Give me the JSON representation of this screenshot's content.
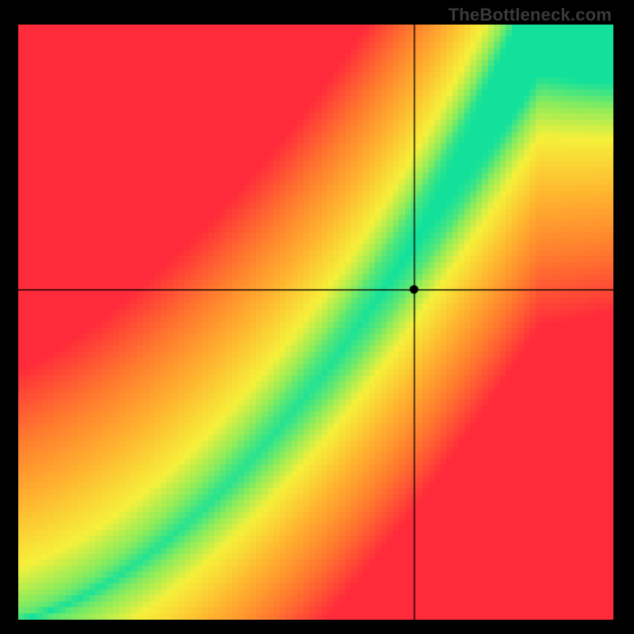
{
  "watermark": "TheBottleneck.com",
  "chart_data": {
    "type": "heatmap",
    "title": "",
    "xlabel": "",
    "ylabel": "",
    "xlim": [
      0,
      1
    ],
    "ylim": [
      0,
      1
    ],
    "crosshair": {
      "x": 0.665,
      "y": 0.555
    },
    "marker": {
      "x": 0.665,
      "y": 0.555
    },
    "optimal_band": {
      "description": "Green optimal region: a curved band from bottom-left to top-right. Color encodes distance from this band (green=on band, yellow=near, red=far).",
      "slope": 1.25,
      "curvature": 0.7,
      "band_halfwidth_at_min": 0.006,
      "band_halfwidth_at_max": 0.085
    },
    "color_stops": {
      "on_band": "#13e19b",
      "near": "#f6f03a",
      "mid": "#ff9a2e",
      "far": "#ff2b3a"
    },
    "pixelation": 100
  }
}
